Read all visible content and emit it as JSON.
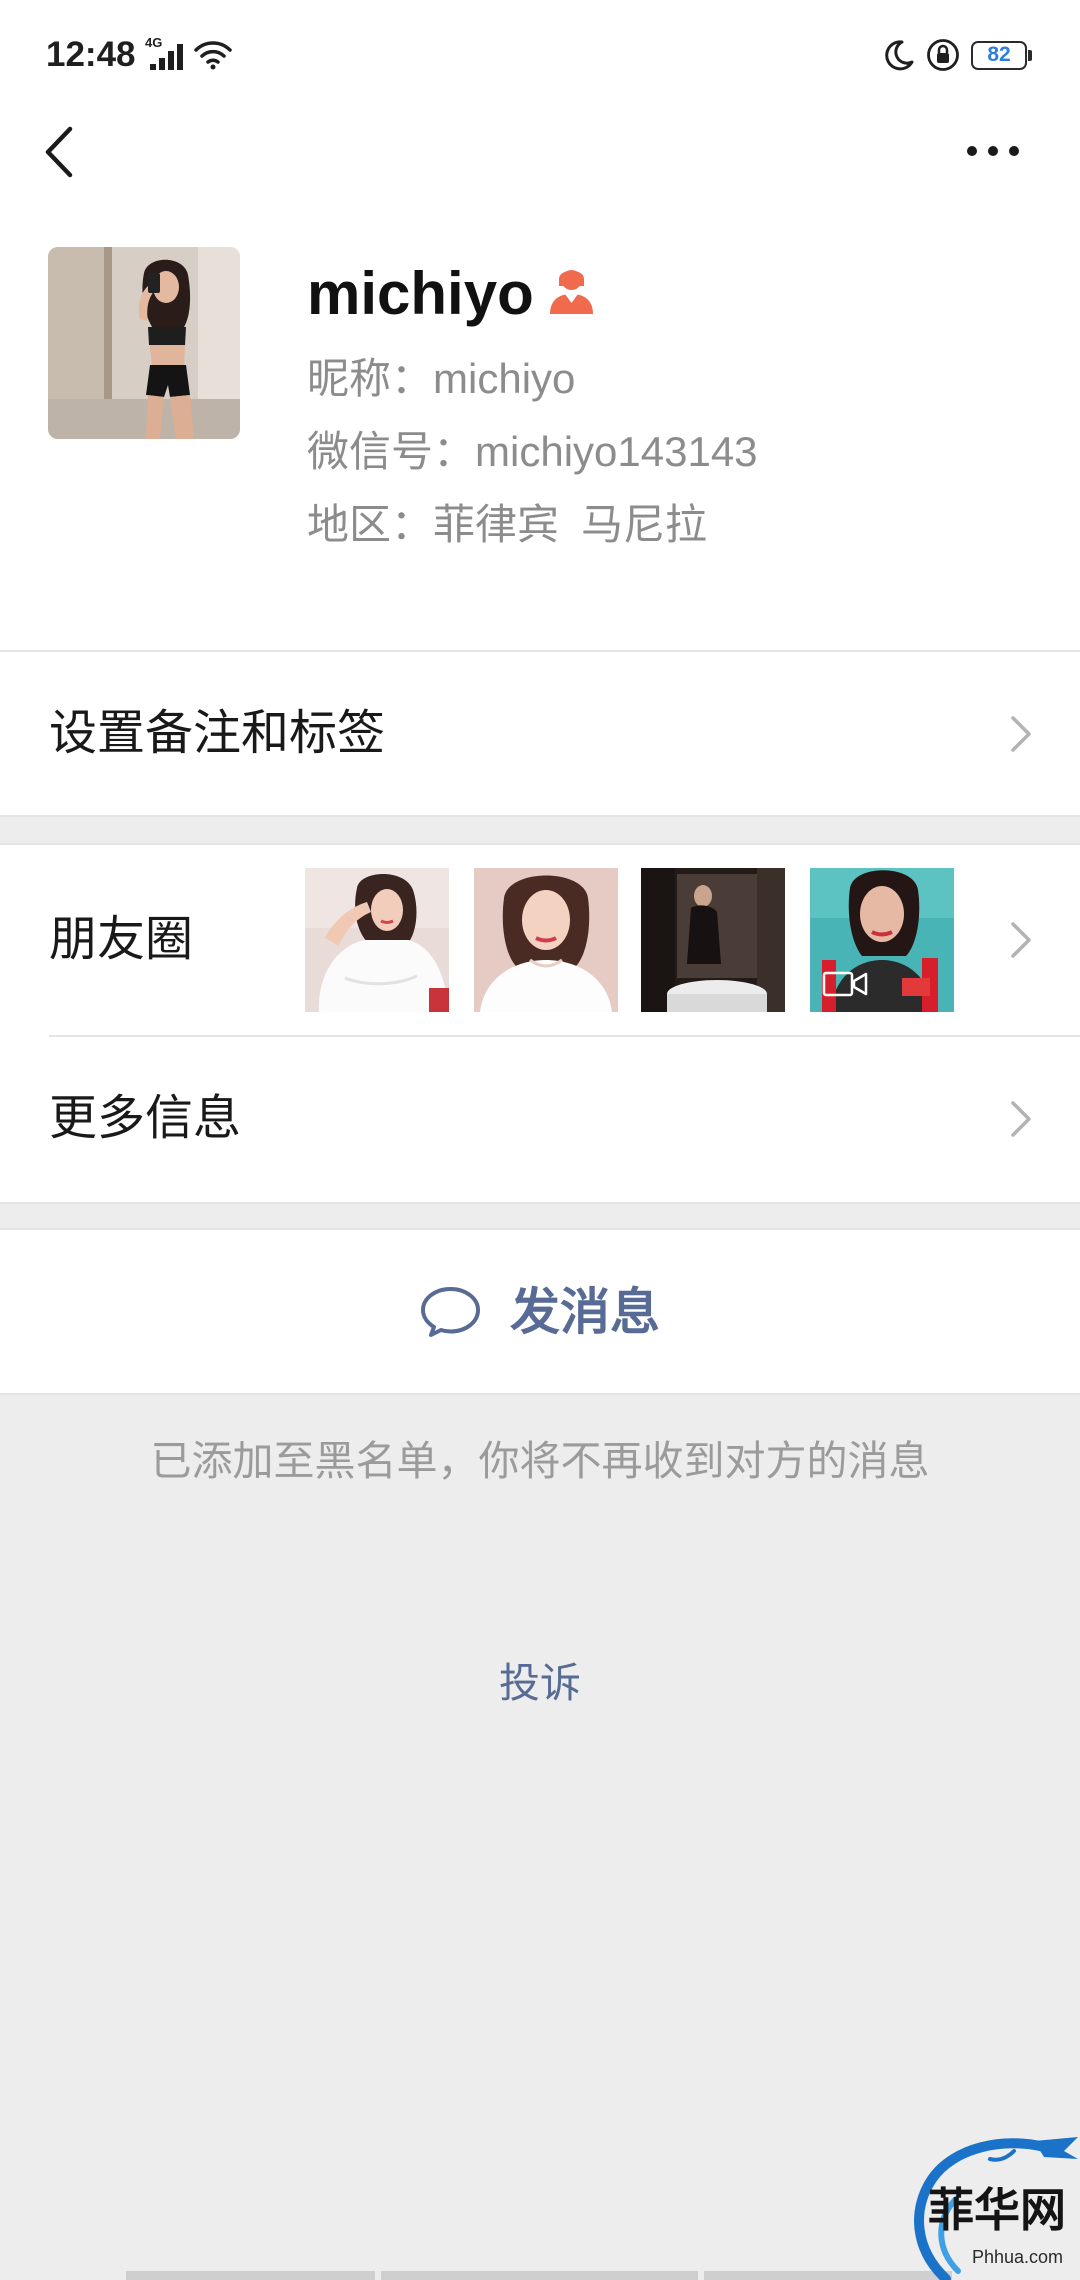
{
  "status_bar": {
    "time": "12:48",
    "network": "4G",
    "battery": "82",
    "icons": [
      "cellular-signal-icon",
      "wifi-icon",
      "moon-icon",
      "rotation-lock-icon",
      "battery-icon"
    ]
  },
  "nav": {
    "back_icon": "chevron-left-icon",
    "more_icon": "ellipsis-icon"
  },
  "profile": {
    "name": "michiyo",
    "gender_icon": "female-icon",
    "nickname_label": "昵称：",
    "nickname": "michiyo",
    "wechat_id_label": "微信号：",
    "wechat_id": "michiyo143143",
    "region_label": "地区：",
    "region_country": "菲律宾",
    "region_city": "马尼拉"
  },
  "rows": {
    "remark_tags": "设置备注和标签",
    "moments": "朋友圈",
    "more_info": "更多信息",
    "chevron_icon": "chevron-right-icon"
  },
  "moments": {
    "video_icon": "video-camera-icon"
  },
  "actions": {
    "send_message": "发消息",
    "send_message_icon": "chat-bubble-icon"
  },
  "blacklist_notice": "已添加至黑名单，你将不再收到对方的消息",
  "complaint": "投诉",
  "watermark": {
    "brand": "菲华网",
    "domain": "Phhua.com"
  },
  "colors": {
    "link": "#576b95",
    "page_background": "#ededed",
    "female_icon": "#f06a4e",
    "battery_level": "#2f7fd8",
    "secondary_text": "#8c8c8c"
  }
}
